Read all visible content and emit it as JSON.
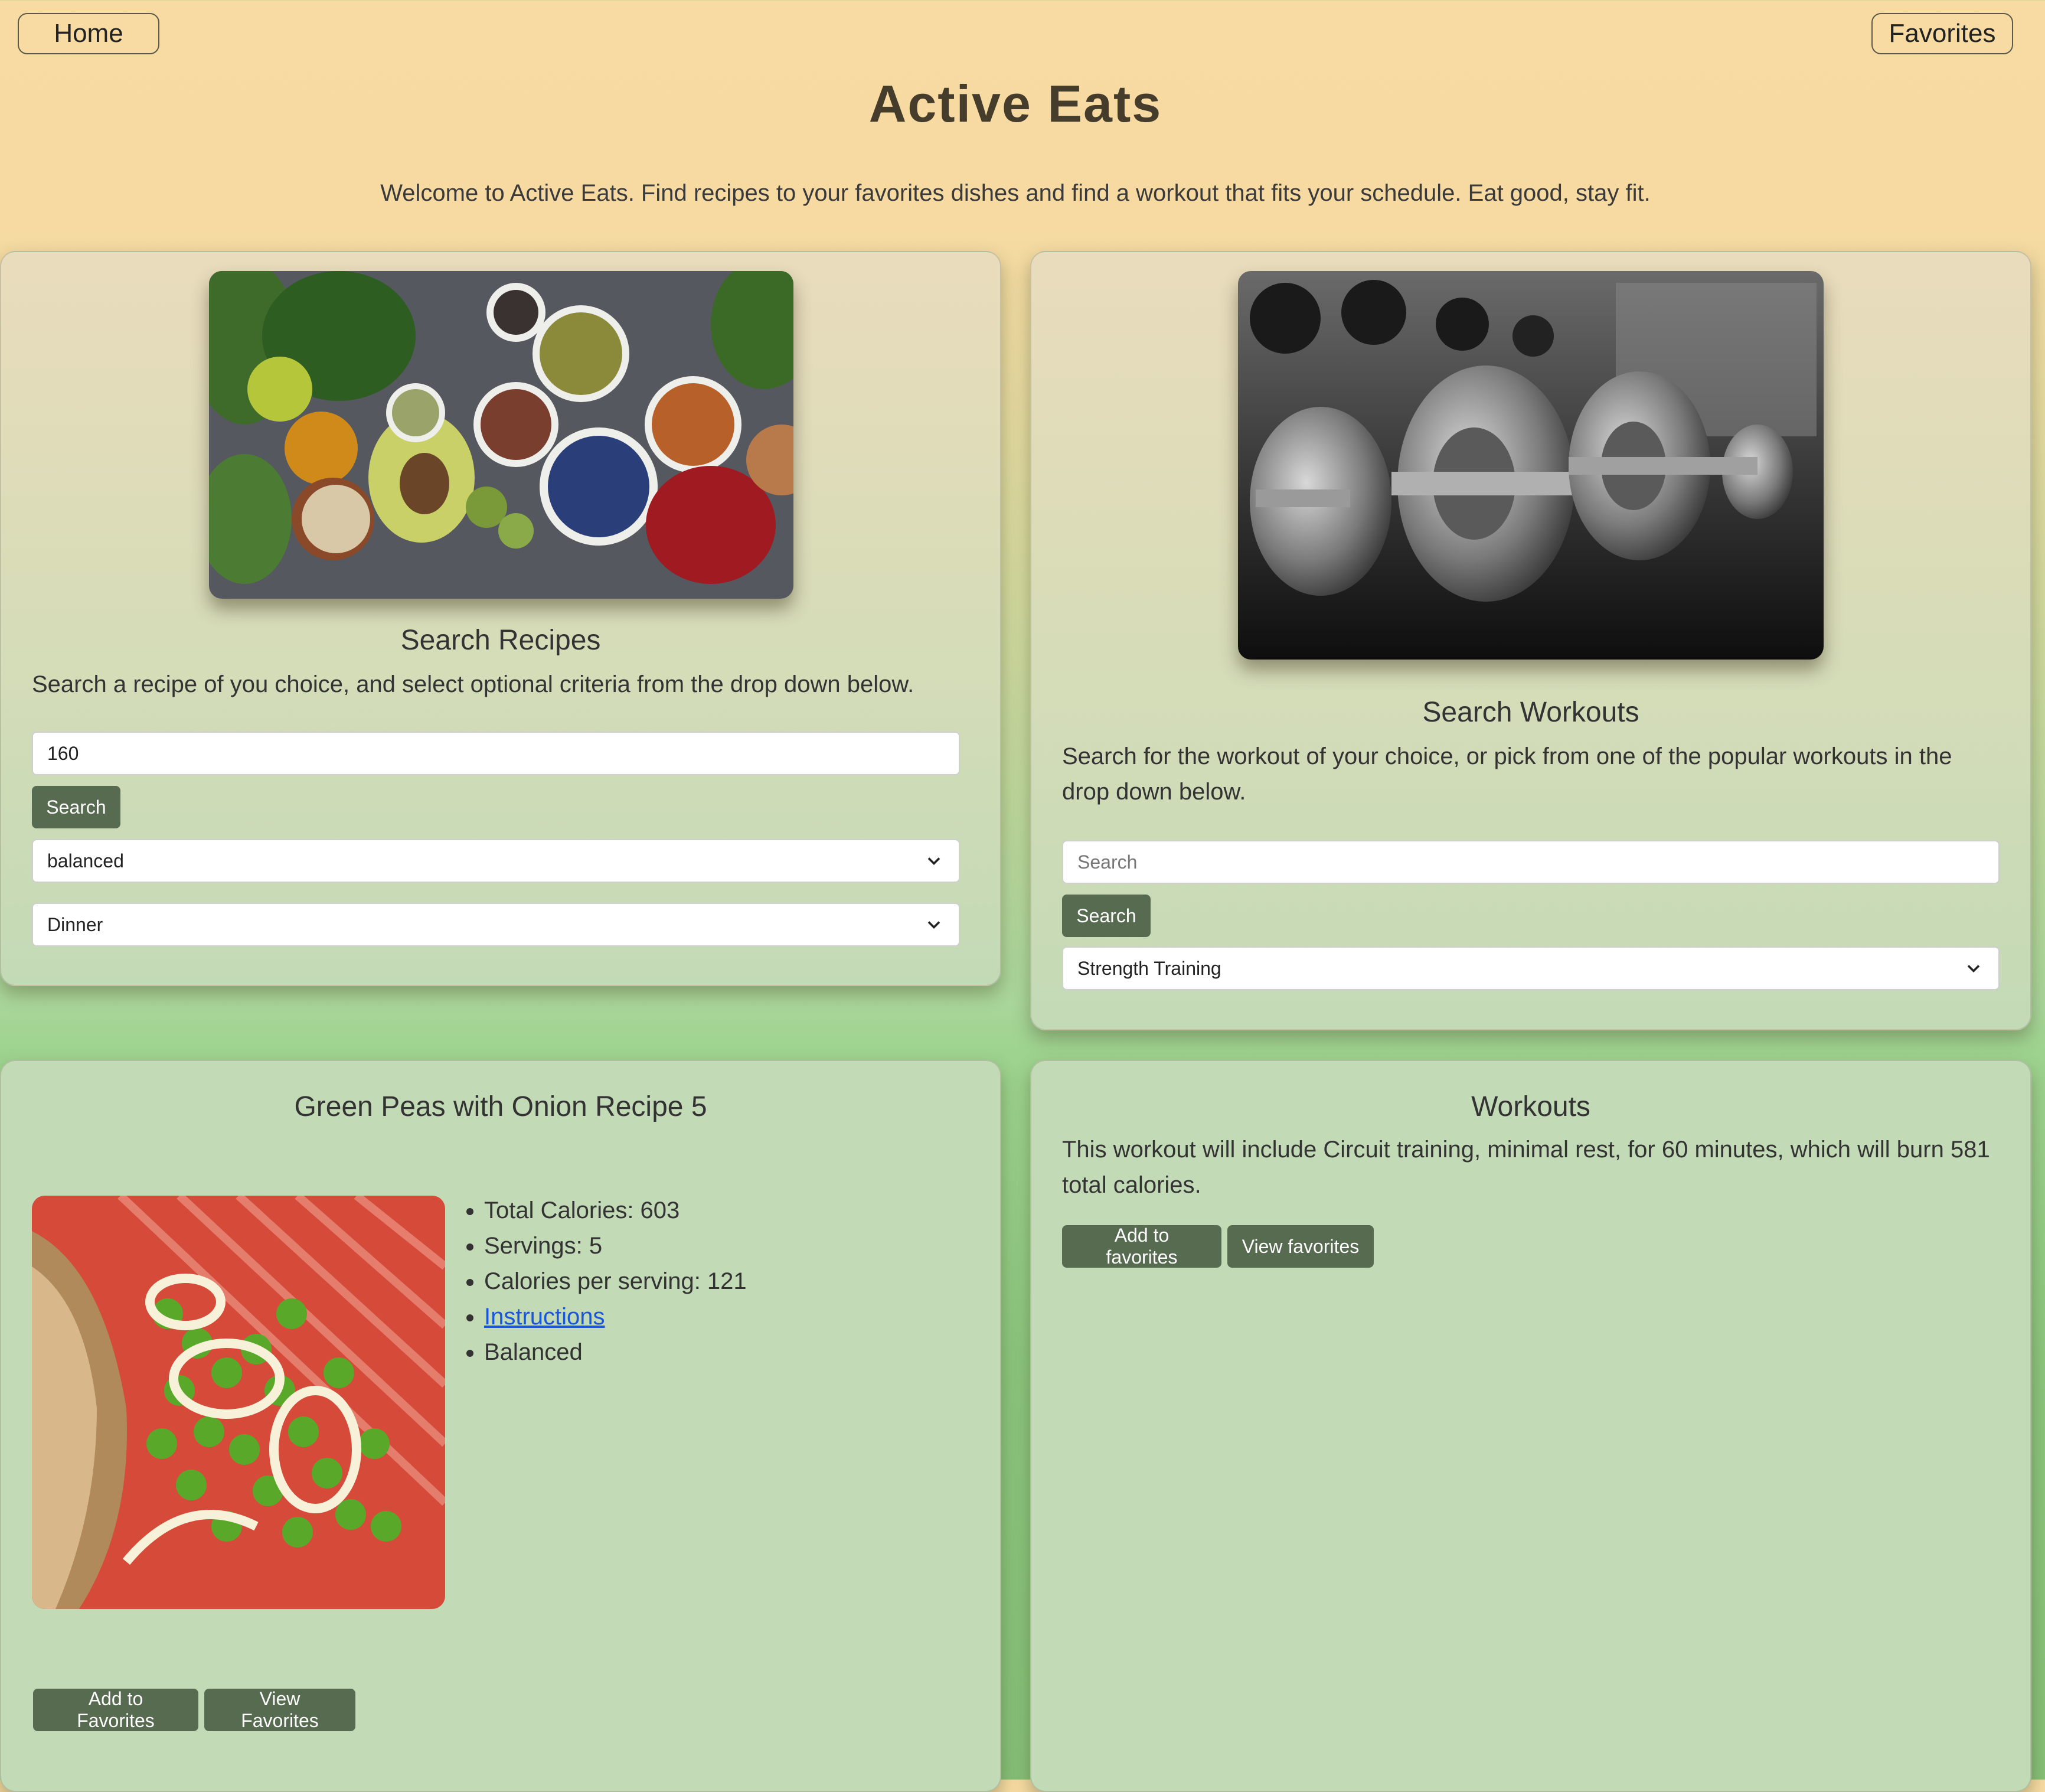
{
  "nav": {
    "home_label": "Home",
    "favorites_label": "Favorites"
  },
  "header": {
    "title": "Active Eats",
    "welcome": "Welcome to Active Eats. Find recipes to your favorites dishes and find a workout that fits your schedule. Eat good, stay fit."
  },
  "recipe_search": {
    "heading": "Search Recipes",
    "description": "Search a recipe of you choice, and select optional criteria from the drop down below.",
    "input_value": "160",
    "search_label": "Search",
    "diet_selected": "balanced",
    "meal_selected": "Dinner"
  },
  "workout_search": {
    "heading": "Search Workouts",
    "description": "Search for the workout of your choice, or pick from one of the popular workouts in the drop down below.",
    "input_placeholder": "Search",
    "search_label": "Search",
    "workout_selected": "Strength Training"
  },
  "recipe_result": {
    "title": "Green Peas with Onion Recipe 5",
    "facts": {
      "total_calories": "Total Calories: 603",
      "servings": "Servings: 5",
      "calories_per_serving": "Calories per serving: 121",
      "instructions_link": "Instructions",
      "diet_label": "Balanced"
    },
    "add_label": "Add to Favorites",
    "view_label": "View Favorites"
  },
  "workout_result": {
    "heading": "Workouts",
    "description": "This workout will include Circuit training, minimal rest, for 60 minutes, which will burn 581 total calories.",
    "add_label": "Add to favorites",
    "view_label": "View favorites"
  },
  "colors": {
    "button_bg": "#566b4f",
    "header_bg": "#f6daa1",
    "card_green": "#c3dab6",
    "link": "#1a56d9"
  }
}
